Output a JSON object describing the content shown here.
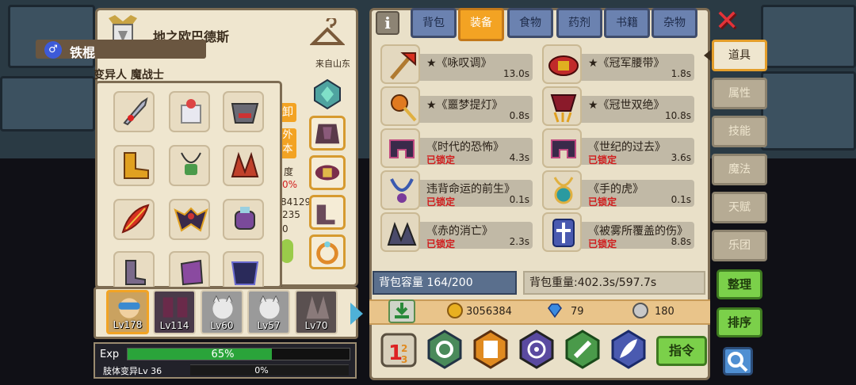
{
  "character": {
    "name": "地之欧巴德斯",
    "weapon": "铁棍",
    "origin": "来自山东",
    "race": "变异人 魔战士"
  },
  "char_panel_peek": {
    "btn_char_1": "卸",
    "btn_char_2": "外",
    "btn_char_3": "本",
    "stat_1": "度",
    "stat_2": "0%",
    "stat_3": "84129",
    "stat_4": "235",
    "stat_5": "0"
  },
  "party": [
    {
      "level": "Lv178",
      "selected": true
    },
    {
      "level": "Lv114",
      "selected": false
    },
    {
      "level": "Lv60",
      "selected": false
    },
    {
      "level": "Lv57",
      "selected": false
    },
    {
      "level": "Lv70",
      "selected": false
    }
  ],
  "exp": {
    "label": "Exp",
    "percent_text": "65%",
    "percent": 65,
    "skill_label": "肢体变异Lv 36",
    "skill_percent_text": "0%"
  },
  "tabs": [
    "背包",
    "装备",
    "食物",
    "药剂",
    "书籍",
    "杂物"
  ],
  "active_tab": "装备",
  "info_label": "i",
  "categories": [
    "道具",
    "属性",
    "技能",
    "魔法",
    "天赋",
    "乐团"
  ],
  "active_category": "道具",
  "items": [
    {
      "name": "★《咏叹调》",
      "weight": "13.0s",
      "locked": ""
    },
    {
      "name": "★《冠军腰带》",
      "weight": "1.8s",
      "locked": ""
    },
    {
      "name": "★《噩梦提灯》",
      "weight": "0.8s",
      "locked": ""
    },
    {
      "name": "★《冠世双绝》",
      "weight": "10.8s",
      "locked": ""
    },
    {
      "name": "《时代的恐怖》",
      "weight": "4.3s",
      "locked": "已锁定"
    },
    {
      "name": "《世纪的过去》",
      "weight": "3.6s",
      "locked": "已锁定"
    },
    {
      "name": "违背命运的前生》",
      "weight": "0.1s",
      "locked": "已锁定"
    },
    {
      "name": "《手的虎》",
      "weight": "0.1s",
      "locked": "已锁定"
    },
    {
      "name": "《赤的消亡》",
      "weight": "2.3s",
      "locked": "已锁定"
    },
    {
      "name": "《被雾所覆盖的伤》",
      "weight": "8.8s",
      "locked": "已锁定"
    }
  ],
  "capacity": "背包容量 164/200",
  "bag_weight": "背包重量:402.3s/597.7s",
  "resources": {
    "gold": "3056384",
    "diamond": "79",
    "silver": "180"
  },
  "buttons": {
    "command": "指令",
    "organize": "整理",
    "sort": "排序",
    "close": "✕"
  },
  "colors": {
    "active_tab": "#f3a323",
    "inactive_tab": "#6b82b0",
    "locked_text": "#d11d1d",
    "exp_fill": "#2aa43a",
    "action_button": "#7bd04a"
  },
  "icons": [
    "crest-icon",
    "hanger-icon",
    "male-icon",
    "info-icon",
    "close-icon",
    "download-icon",
    "gold-coin-icon",
    "diamond-icon",
    "silver-coin-icon",
    "search-icon",
    "priority-123-icon",
    "team-gear-icon",
    "cards-icon",
    "warp-icon",
    "potion-icon",
    "feather-icon"
  ]
}
